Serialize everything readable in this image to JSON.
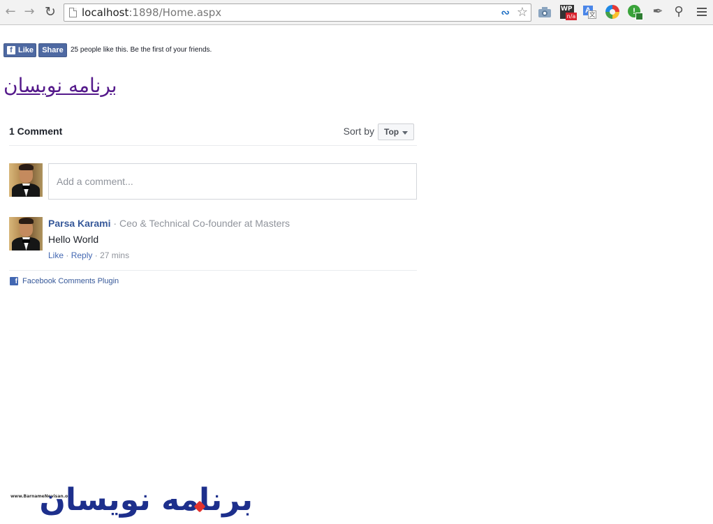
{
  "browser": {
    "url_host": "localhost",
    "url_rest": ":1898/Home.aspx",
    "icons": {
      "back": "back-arrow-icon",
      "forward": "forward-arrow-icon",
      "reload": "reload-icon",
      "page": "page-icon",
      "bookmark": "star-icon",
      "menu": "hamburger-menu-icon"
    },
    "extension_wp_badge": "n/a"
  },
  "like_bar": {
    "like_label": "Like",
    "share_label": "Share",
    "social_text": "25 people like this. Be the first of your friends."
  },
  "page": {
    "heading_link": "برنامه نویسان"
  },
  "comments": {
    "count_label": "1 Comment",
    "sort_label": "Sort by",
    "sort_value": "Top",
    "input_placeholder": "Add a comment...",
    "items": [
      {
        "author": "Parsa Karami",
        "separator": "·",
        "author_title": "Ceo & Technical Co-founder at Masters",
        "text": "Hello World",
        "like_label": "Like",
        "reply_label": "Reply",
        "time": "27 mins"
      }
    ],
    "footer_label": "Facebook Comments Plugin"
  },
  "logo": {
    "url_text": "www.BarnameNevisan.org",
    "text": "برنامه نویسان"
  },
  "colors": {
    "facebook_blue": "#4e69a2",
    "link_blue": "#365899",
    "visited_link": "#551a8b",
    "logo_blue": "#1d2f8c",
    "logo_red": "#e3322d"
  }
}
